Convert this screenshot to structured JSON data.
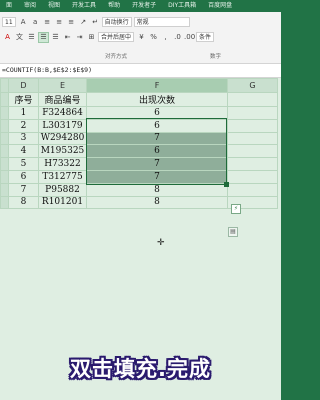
{
  "menu_tabs": [
    "面",
    "审阅",
    "视图",
    "开发工具",
    "帮助",
    "开发者子",
    "DIY工具箱",
    "百度网盘"
  ],
  "ribbon": {
    "font_size": "11",
    "wrap_text": "自动换行",
    "merge_center": "合并后居中",
    "number_format": "常规",
    "conditional": "条件",
    "group_alignment": "对齐方式",
    "group_number": "数字"
  },
  "formula_bar": {
    "formula": "=COUNTIF(B:B,$E$2:$E$9)"
  },
  "columns": [
    "D",
    "E",
    "F",
    "G"
  ],
  "table": {
    "headers": [
      "序号",
      "商品编号",
      "出现次数"
    ],
    "rows": [
      {
        "seq": "1",
        "code": "F324864",
        "count": "6"
      },
      {
        "seq": "2",
        "code": "L303179",
        "count": "6"
      },
      {
        "seq": "3",
        "code": "W294280",
        "count": "7"
      },
      {
        "seq": "4",
        "code": "M195325",
        "count": "6"
      },
      {
        "seq": "5",
        "code": "H73322",
        "count": "7"
      },
      {
        "seq": "6",
        "code": "T312775",
        "count": "7"
      },
      {
        "seq": "7",
        "code": "P95882",
        "count": "8"
      },
      {
        "seq": "8",
        "code": "R101201",
        "count": "8"
      }
    ]
  },
  "caption": "双击填充.完成",
  "icons": {
    "quick_analysis": "quick-analysis-icon",
    "paste_options": "paste-options-icon",
    "cursor": "cell-cursor-icon"
  },
  "colors": {
    "excel_green": "#217346",
    "grid_bg": "#dfeee2",
    "selected_fill": "#8fae9a",
    "selection_border": "#1e6b3a",
    "caption_outline": "#2a1a6e"
  }
}
